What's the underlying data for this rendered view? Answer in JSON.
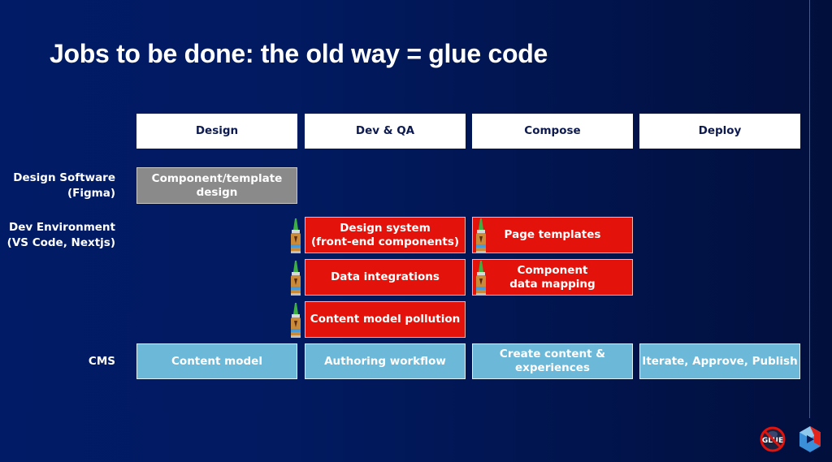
{
  "title": "Jobs to be done: the old way = glue code",
  "columns": [
    {
      "label": "Design"
    },
    {
      "label": "Dev & QA"
    },
    {
      "label": "Compose"
    },
    {
      "label": "Deploy"
    }
  ],
  "rows": [
    {
      "label_line1": "Design Software",
      "label_line2": "(Figma)"
    },
    {
      "label_line1": "Dev Environment",
      "label_line2": "(VS Code, Nextjs)"
    },
    {
      "label_line1": "CMS",
      "label_line2": ""
    }
  ],
  "cells": {
    "design_software": {
      "component_template_design": "Component/template design"
    },
    "dev_environment": {
      "design_system_line1": "Design system",
      "design_system_line2": "(front-end components)",
      "data_integrations": "Data integrations",
      "content_model_pollution": "Content model pollution",
      "page_templates": "Page templates",
      "component_data_mapping": "Component data mapping"
    },
    "cms": {
      "content_model": "Content model",
      "authoring_workflow": "Authoring workflow",
      "create_content": "Create content & experiences",
      "iterate_publish": "Iterate, Approve, Publish"
    }
  },
  "glue_markers": [
    "design-system",
    "data-integrations",
    "content-model-pollution",
    "page-templates",
    "component-data-mapping"
  ],
  "logos": {
    "no_glue_text": "GLUE"
  },
  "colors": {
    "background": "#011a60",
    "header_box": "#ffffff",
    "header_text": "#0d1a4f",
    "tool_gray": "#8a8a8a",
    "glue_red": "#e3120b",
    "cms_blue": "#6bb8d8"
  }
}
